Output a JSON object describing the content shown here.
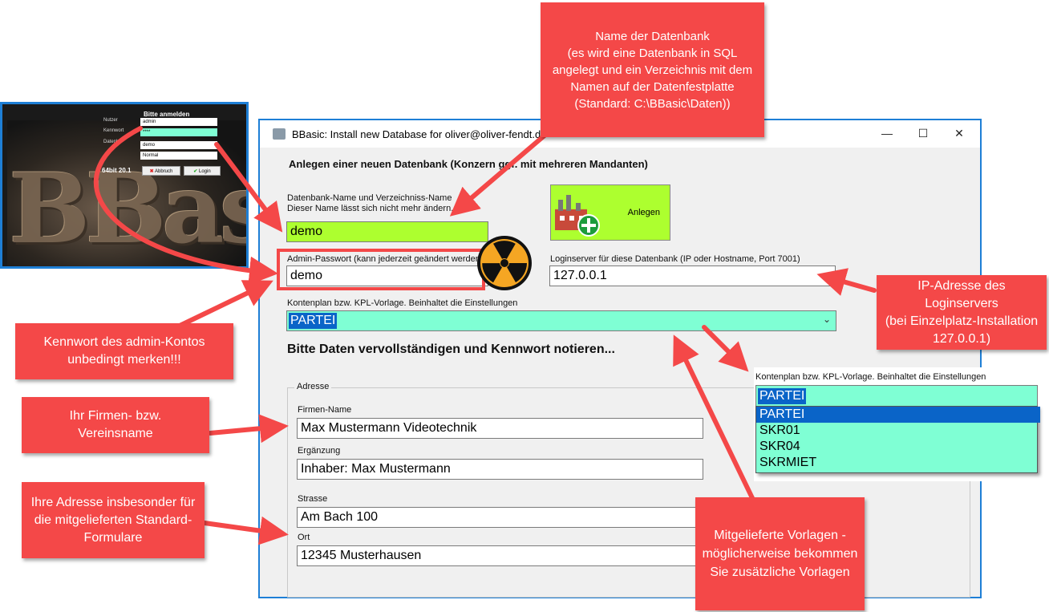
{
  "login": {
    "title": "Bitte anmelden",
    "user_label": "Nutzer",
    "user_value": "admin",
    "password_label": "Kennwort",
    "password_value": "****",
    "database_label": "Datenb",
    "database_value": "demo",
    "mode_value": "Normal",
    "version": "64bit 20.1",
    "cancel_label": "Abbruch",
    "login_label": "Login",
    "logo_text": "BBasic"
  },
  "window": {
    "title": "BBasic: Install new Database for oliver@oliver-fendt.de",
    "heading": "Anlegen einer neuen Datenbank (Konzern ggf. mit mehreren Mandanten)",
    "db_name_label_1": "Datenbank-Name und Verzeichniss-Name",
    "db_name_label_2": "Dieser Name lässt sich nicht mehr ändern.",
    "db_name_value": "demo",
    "admin_pw_label": "Admin-Passwort (kann jederzeit geändert werden)",
    "admin_pw_value": "demo",
    "login_server_label": "Loginserver für diese Datenbank (IP oder Hostname, Port 7001)",
    "login_server_value": "127.0.0.1",
    "chart_of_accounts_label": "Kontenplan bzw. KPL-Vorlage. Beinhaltet die Einstellungen",
    "chart_of_accounts_value": "PARTEI",
    "anlegen_label": "Anlegen",
    "prompt": "Bitte Daten vervollständigen und Kennwort notieren...",
    "address": {
      "legend": "Adresse",
      "company_label": "Firmen-Name",
      "company_value": "Max Mustermann Videotechnik",
      "addition_label": "Ergänzung",
      "addition_value": "Inhaber: Max Mustermann",
      "street_label": "Strasse",
      "street_value": "Am Bach 100",
      "city_label": "Ort",
      "city_value": "12345 Musterhausen"
    }
  },
  "dropdown_popup": {
    "label": "Kontenplan bzw. KPL-Vorlage. Beinhaltet die Einstellungen",
    "selected": "PARTEI",
    "options": [
      "PARTEI",
      "SKR01",
      "SKR04",
      "SKRMIET"
    ]
  },
  "callouts": {
    "db_name": "Name der Datenbank\n(es wird eine Datenbank in SQL angelegt und ein Verzeichnis mit dem Namen auf der Datenfestplatte (Standard: C:\\BBasic\\Daten))",
    "ip_address": "IP-Adresse des Loginservers\n(bei Einzelplatz-Installation 127.0.0.1)",
    "admin_password": "Kennwort des admin-Kontos unbedingt merken!!!",
    "company": "Ihr Firmen- bzw. Vereinsname",
    "address": "Ihre Adresse insbesonder für die mitgelieferten Standard-Formulare",
    "templates": "Mitgelieferte Vorlagen - möglicherweise bekommen Sie zusätzliche Vorlagen"
  },
  "colors": {
    "callout": "#f44848",
    "window_border": "#1e7fd6",
    "db_name_field": "#adff2f",
    "dropdown_field": "#7fffd4",
    "selection": "#0a64c8",
    "radiation_yellow": "#f5a623"
  }
}
